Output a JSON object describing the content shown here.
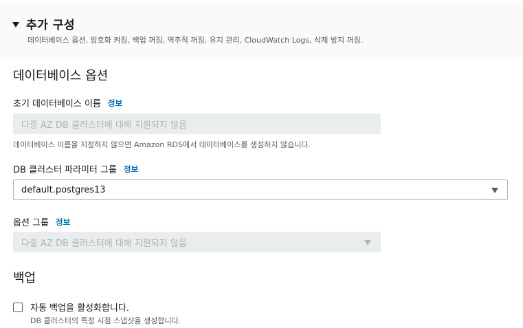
{
  "section": {
    "title": "추가 구성",
    "description": "데이터베이스 옵션, 암호화 켜짐, 백업 꺼짐, 역추적 꺼짐, 유지 관리, CloudWatch Logs, 삭제 방지 꺼짐."
  },
  "database_options": {
    "heading": "데이터베이스 옵션",
    "initial_db_name": {
      "label": "초기 데이터베이스 이름",
      "info": "정보",
      "placeholder": "다중 AZ DB 클러스터에 대해 지원되지 않음",
      "hint": "데이터베이스 이름을 지정하지 않으면 Amazon RDS에서 데이터베이스를 생성하지 않습니다."
    },
    "cluster_param_group": {
      "label": "DB 클러스터 파라미터 그룹",
      "info": "정보",
      "value": "default.postgres13"
    },
    "option_group": {
      "label": "옵션 그룹",
      "info": "정보",
      "placeholder": "다중 AZ DB 클러스터에 대해 지원되지 않음"
    }
  },
  "backup": {
    "heading": "백업",
    "enable_backup": {
      "label": "자동 백업을 활성화합니다.",
      "description": "DB 클러스터의 특정 시점 스냅샷을 생성합니다.",
      "checked": false
    }
  }
}
